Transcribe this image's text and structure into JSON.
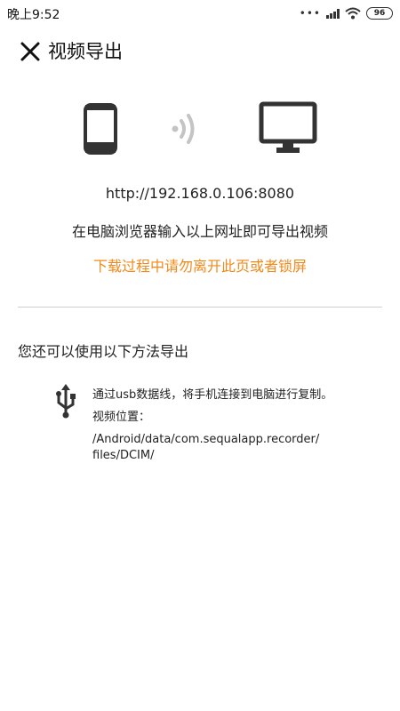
{
  "status_bar": {
    "time": "晚上9:52",
    "battery": "96"
  },
  "header": {
    "title": "视频导出"
  },
  "main": {
    "url": "http://192.168.0.106:8080",
    "instruction": "在电脑浏览器输入以上网址即可导出视频",
    "warning": "下载过程中请勿离开此页或者锁屏",
    "warning_color": "#f08a1c"
  },
  "alternative": {
    "heading": "您还可以使用以下方法导出",
    "usb_description": "通过usb数据线，将手机连接到电脑进行复制。",
    "location_label": "视频位置：",
    "path_line1": "/Android/data/com.sequalapp.recorder/",
    "path_line2": "files/DCIM/"
  },
  "icons": [
    "close-icon",
    "phone-icon",
    "wireless-signal-icon",
    "monitor-icon",
    "usb-icon",
    "wifi-icon",
    "signal-icon",
    "battery-icon"
  ]
}
